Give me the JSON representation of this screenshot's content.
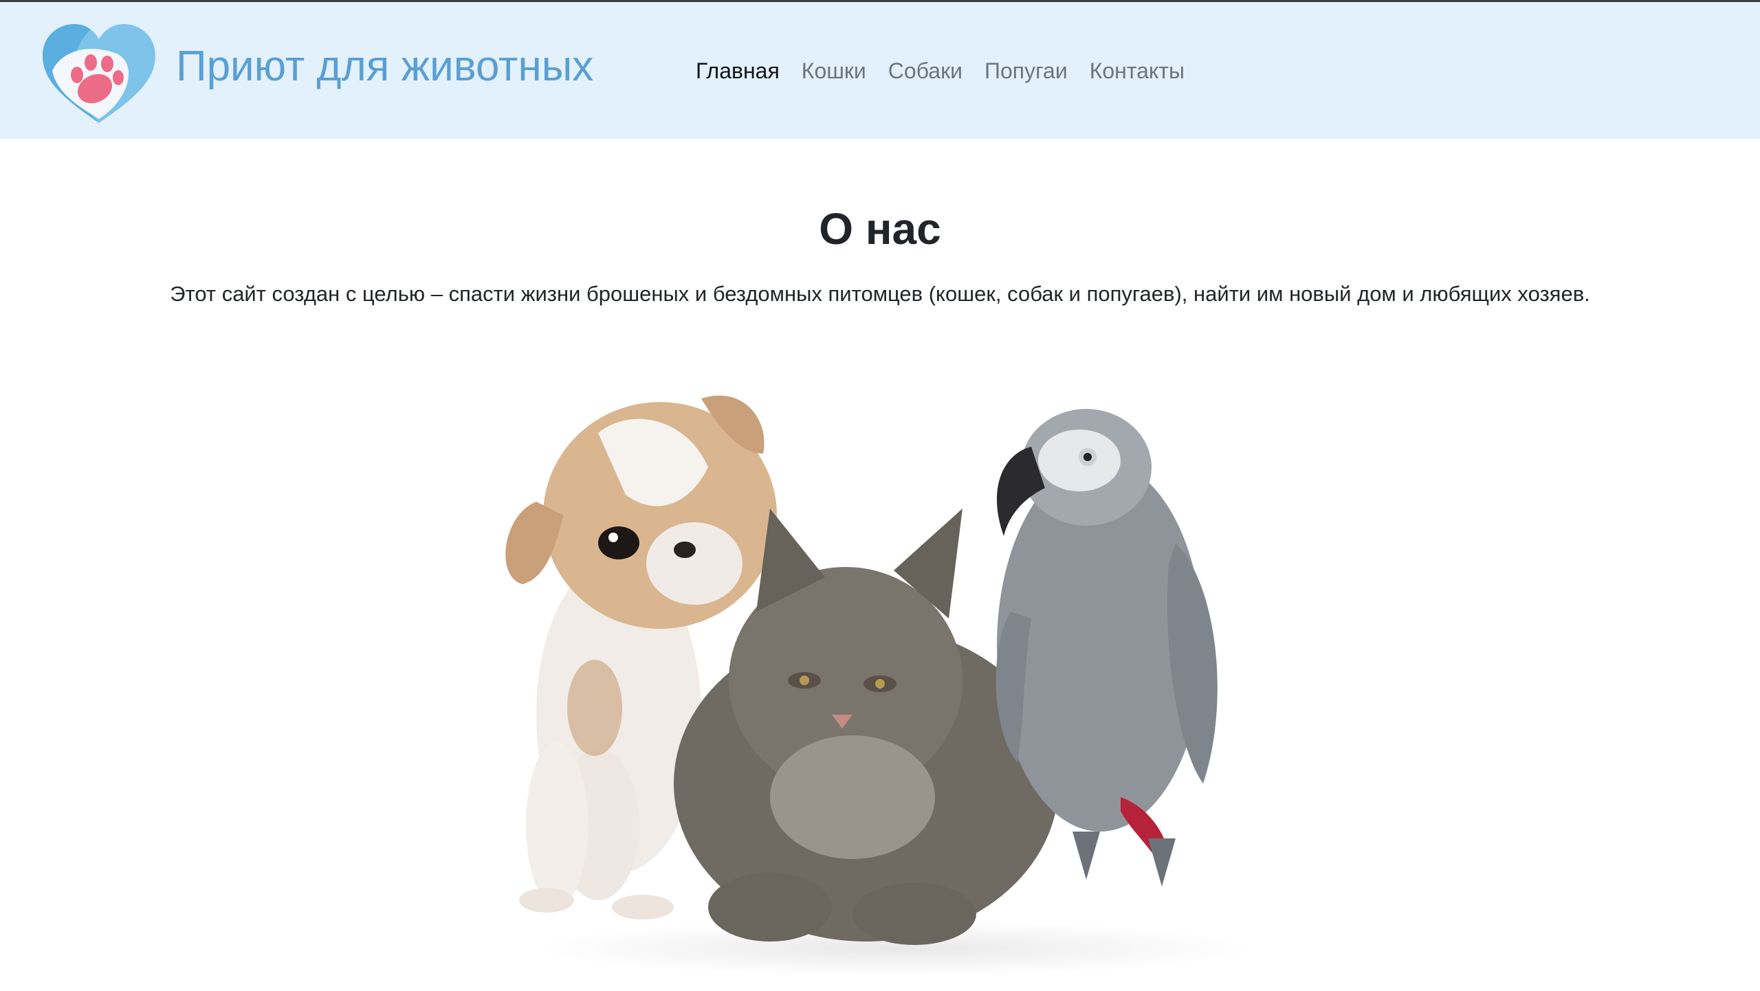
{
  "header": {
    "brand": "Приют для животных",
    "logo_icon": "heart-paw-icon",
    "nav": [
      {
        "label": "Главная",
        "active": true
      },
      {
        "label": "Кошки",
        "active": false
      },
      {
        "label": "Собаки",
        "active": false
      },
      {
        "label": "Попугаи",
        "active": false
      },
      {
        "label": "Контакты",
        "active": false
      }
    ]
  },
  "main": {
    "title": "О нас",
    "description": "Этот сайт создан с целью – спасти жизни брошеных и бездомных питомцев (кошек, собак и попугаев), найти им новый дом и любящих хозяев.",
    "hero_image": "puppy-kitten-parrot-photo"
  },
  "colors": {
    "navbar_bg": "#e3f1fc",
    "brand": "#5a9fd4",
    "nav_inactive": "#6c757d",
    "nav_active": "#111418"
  }
}
